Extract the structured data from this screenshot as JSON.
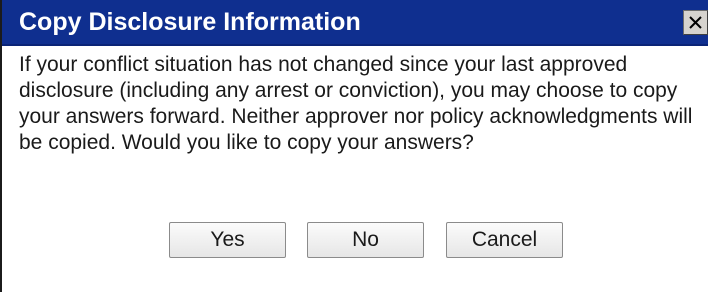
{
  "dialog": {
    "title": "Copy Disclosure Information",
    "close_icon": "close-icon",
    "message": "If your conflict situation has not changed since your last approved disclosure (including any arrest or conviction), you may choose to copy your answers forward. Neither approver nor policy acknowledgments will be copied. Would you like to copy your answers?",
    "buttons": {
      "yes": "Yes",
      "no": "No",
      "cancel": "Cancel"
    }
  },
  "colors": {
    "titlebar": "#0f2f8f",
    "title_text": "#ffffff",
    "body_background": "#ffffff",
    "body_text": "#1a1a1a"
  }
}
